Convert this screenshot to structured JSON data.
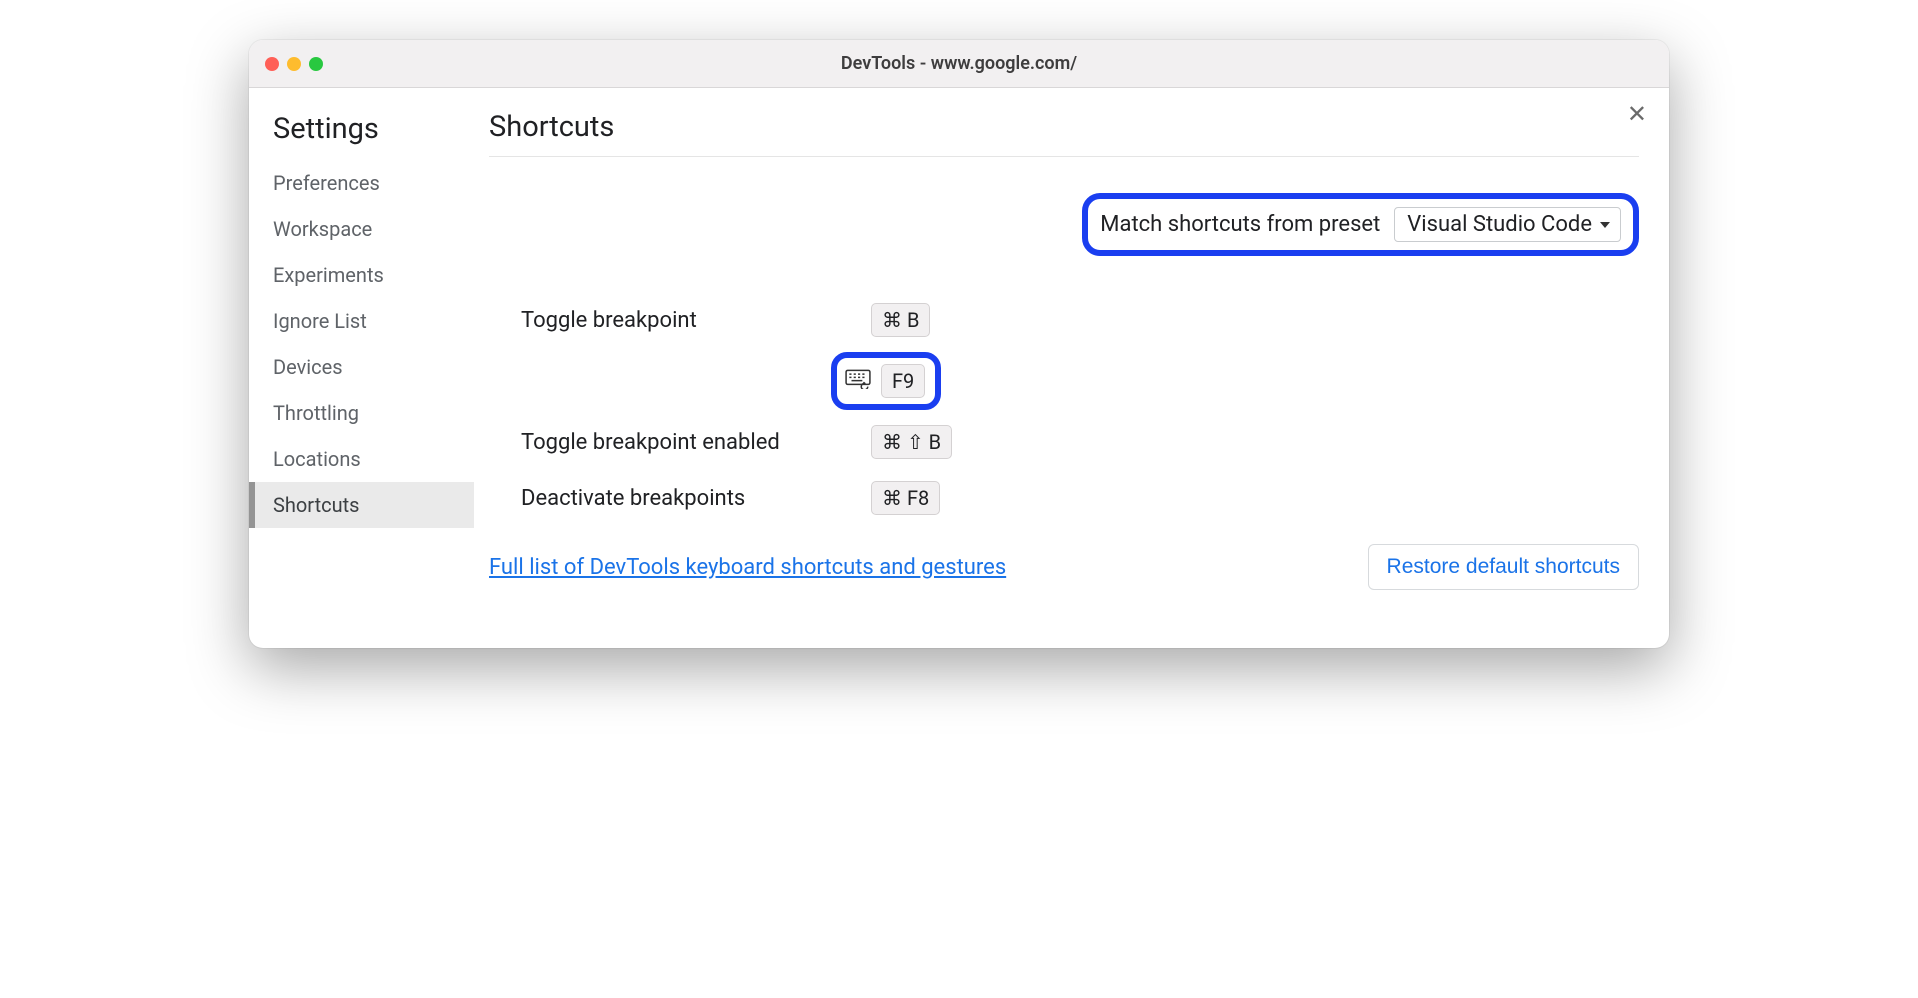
{
  "window": {
    "title": "DevTools - www.google.com/"
  },
  "sidebar": {
    "title": "Settings",
    "items": [
      "Preferences",
      "Workspace",
      "Experiments",
      "Ignore List",
      "Devices",
      "Throttling",
      "Locations",
      "Shortcuts"
    ],
    "activeIndex": 7
  },
  "main": {
    "title": "Shortcuts",
    "preset": {
      "label": "Match shortcuts from preset",
      "value": "Visual Studio Code"
    },
    "f9Key": "F9",
    "shortcuts": [
      {
        "label": "Toggle breakpoint",
        "keys": "⌘ B"
      },
      {
        "label": "Toggle breakpoint enabled",
        "keys": "⌘ ⇧ B"
      },
      {
        "label": "Deactivate breakpoints",
        "keys": "⌘ F8"
      }
    ],
    "link": "Full list of DevTools keyboard shortcuts and gestures",
    "restoreButton": "Restore default shortcuts"
  }
}
